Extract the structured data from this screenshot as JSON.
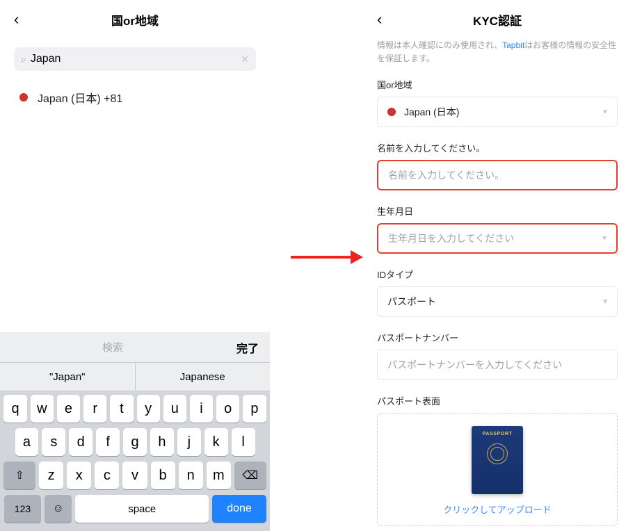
{
  "left": {
    "title": "国or地域",
    "search": {
      "value": "Japan",
      "placeholder": ""
    },
    "result": {
      "text": "Japan (日本)  +81"
    }
  },
  "keyboard": {
    "topSearch": "検索",
    "topDone": "完了",
    "suggestions": [
      "\"Japan\"",
      "Japanese"
    ],
    "row1": [
      "q",
      "w",
      "e",
      "r",
      "t",
      "y",
      "u",
      "i",
      "o",
      "p"
    ],
    "row2": [
      "a",
      "s",
      "d",
      "f",
      "g",
      "h",
      "j",
      "k",
      "l"
    ],
    "shift": "⇧",
    "row3": [
      "z",
      "x",
      "c",
      "v",
      "b",
      "n",
      "m"
    ],
    "backspace": "⌫",
    "numKey": "123",
    "emoji": "☺",
    "space": "space",
    "done": "done"
  },
  "right": {
    "title": "KYC認証",
    "info_pre": "情報は本人確認にのみ使用され、",
    "info_link": "Tapbit",
    "info_post": "はお客様の情報の安全性を保証します。",
    "region_label": "国or地域",
    "region_value": "Japan (日本)",
    "name_label": "名前を入力してください。",
    "name_placeholder": "名前を入力してください。",
    "dob_label": "生年月日",
    "dob_placeholder": "生年月日を入力してください",
    "idtype_label": "IDタイプ",
    "idtype_value": "パスポート",
    "passnum_label": "パスポートナンバー",
    "passnum_placeholder": "パスポートナンバーを入力してください",
    "passface_label": "パスポート表面",
    "passport_word": "PASSPORT",
    "upload_text": "クリックしてアップロード"
  }
}
